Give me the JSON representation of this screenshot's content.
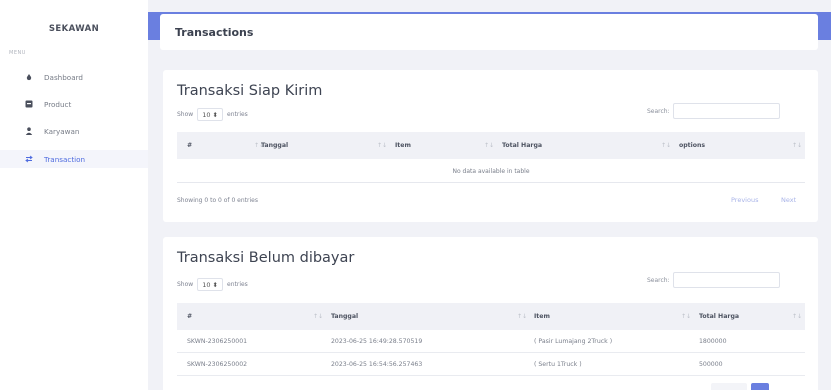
{
  "sidebar": {
    "brand": "SEKAWAN",
    "menu_label": "MENU",
    "items": [
      {
        "label": "Dashboard",
        "icon": "dashboard-icon"
      },
      {
        "label": "Product",
        "icon": "product-icon"
      },
      {
        "label": "Karyawan",
        "icon": "user-icon"
      },
      {
        "label": "Transaction",
        "icon": "transaction-icon",
        "active": true
      }
    ]
  },
  "header": {
    "title": "Transactions"
  },
  "siap_kirim": {
    "title": "Transaksi Siap Kirim",
    "show_label": "Show",
    "entries_value": "10 ⬍",
    "entries_label": "entries",
    "search_label": "Search:",
    "columns": [
      "#",
      "Tanggal",
      "Item",
      "Total Harga",
      "options"
    ],
    "empty_text": "No data available in table",
    "info": "Showing 0 to 0 of 0 entries",
    "previous": "Previous",
    "next": "Next"
  },
  "belum_dibayar": {
    "title": "Transaksi Belum dibayar",
    "show_label": "Show",
    "entries_value": "10 ⬍",
    "entries_label": "entries",
    "search_label": "Search:",
    "columns": [
      "#",
      "Tanggal",
      "Item",
      "Total Harga"
    ],
    "rows": [
      {
        "id": "SKWN-2306250001",
        "tanggal": "2023-06-25 16:49:28.570519",
        "item": "( Pasir Lumajang 2Truck )",
        "total": "1800000"
      },
      {
        "id": "SKWN-2306250002",
        "tanggal": "2023-06-25 16:54:56.257463",
        "item": "( Sertu 1Truck )",
        "total": "500000"
      }
    ]
  },
  "colors": {
    "accent": "#6a7fe0",
    "active_text": "#4f6cdf",
    "background": "#f1f2f7"
  }
}
